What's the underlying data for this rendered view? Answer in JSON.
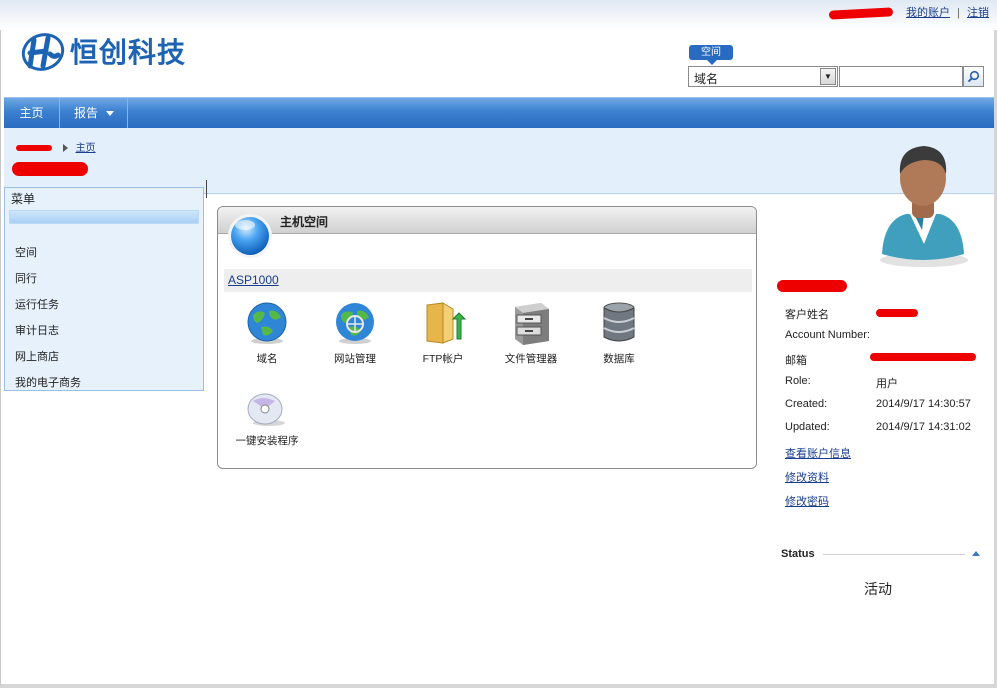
{
  "header": {
    "account_link": "我的账户",
    "separator": "|",
    "logout_link": "注销",
    "logo_text": "恒创科技"
  },
  "search": {
    "badge": "空间",
    "scope_value": "域名",
    "query_value": ""
  },
  "nav": {
    "home": "主页",
    "report": "报告"
  },
  "breadcrumb": {
    "current": "主页"
  },
  "menu": {
    "title": "菜单",
    "items": [
      "空间",
      "同行",
      "运行任务",
      "审计日志",
      "网上商店",
      "我的电子商务"
    ]
  },
  "hosting": {
    "title": "主机空间",
    "plan": "ASP1000",
    "tools": [
      "域名",
      "网站管理",
      "FTP帐户",
      "文件管理器",
      "数据库",
      "一键安装程序"
    ]
  },
  "profile": {
    "fields": [
      {
        "label": "客户姓名",
        "value": ""
      },
      {
        "label": "Account Number:",
        "value": ""
      },
      {
        "label": "邮箱",
        "value": ""
      },
      {
        "label": "Role:",
        "value": "用户"
      },
      {
        "label": "Created:",
        "value": "2014/9/17 14:30:57"
      },
      {
        "label": "Updated:",
        "value": "2014/9/17 14:31:02"
      }
    ],
    "links": [
      "查看账户信息",
      "修改资料",
      "修改密码"
    ]
  },
  "status": {
    "heading": "Status",
    "value": "活动"
  },
  "colors": {
    "nav_blue": "#3c80d0",
    "brand_blue": "#1d63b4",
    "redaction": "#ee0000"
  }
}
